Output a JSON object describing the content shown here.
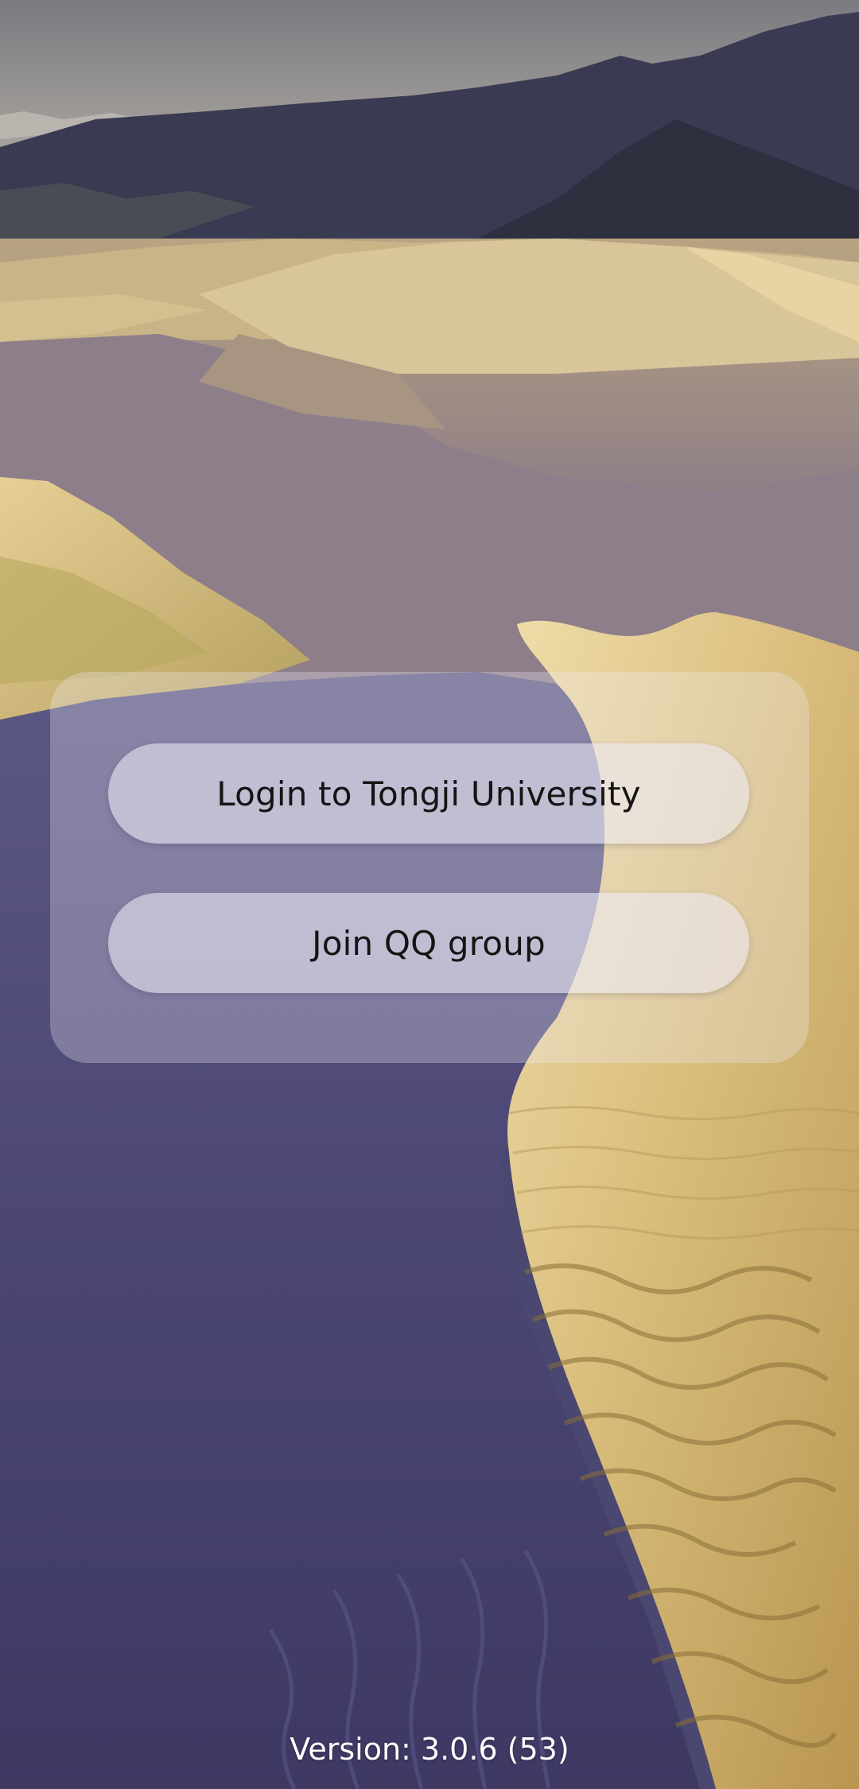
{
  "background": {
    "description_icon": "desert-dunes-wallpaper",
    "colors": {
      "sky": "#8c8a8f",
      "mountains": "#3a3a52",
      "sand_light": "#e2c98c",
      "sand_shadow": "#4c4877"
    }
  },
  "panel": {
    "login_button_label": "Login to Tongji University",
    "qq_button_label": "Join QQ group"
  },
  "footer": {
    "version_text": "Version: 3.0.6 (53)"
  }
}
